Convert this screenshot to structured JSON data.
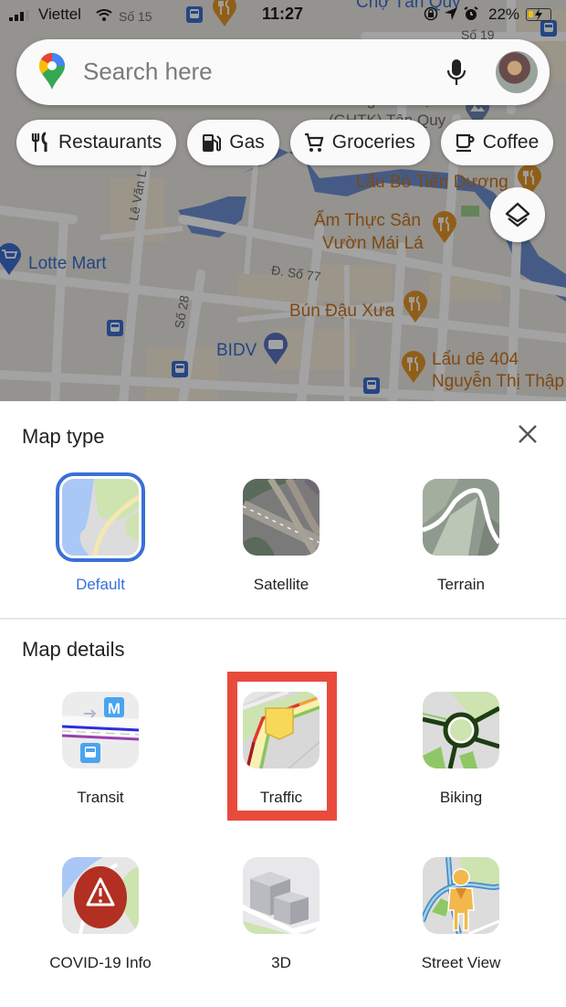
{
  "status_bar": {
    "carrier": "Viettel",
    "time": "11:27",
    "battery_percent": "22%",
    "icons": [
      "signal-icon",
      "wifi-icon",
      "orientation-lock-icon",
      "location-arrow-icon",
      "alarm-icon",
      "battery-charging-icon"
    ]
  },
  "search": {
    "placeholder": "Search here",
    "icons": [
      "google-maps-logo",
      "microphone-icon",
      "avatar"
    ]
  },
  "chips": [
    {
      "label": "Restaurants",
      "icon": "fork-knife-icon"
    },
    {
      "label": "Gas",
      "icon": "gas-pump-icon"
    },
    {
      "label": "Groceries",
      "icon": "cart-icon"
    },
    {
      "label": "Coffee",
      "icon": "coffee-cup-icon"
    }
  ],
  "map": {
    "labels": {
      "lau_bo": "Lẩu Bò Tiến Dương",
      "am_thuc_1": "Ẩm Thực Sân",
      "am_thuc_2": "Vườn Mái Lá",
      "lotte": "Lotte Mart",
      "street_77": "Đ. Số 77",
      "bun_dau": "Bún Đậu Xưa",
      "bidv": "BIDV",
      "lau_de_1": "Lẩu dê 404",
      "lau_de_2": "Nguyễn Thị Thập",
      "le_van": "Lê Văn L",
      "so_28": "Số 28",
      "so_19": "Số 19",
      "so_15": "Số 15",
      "cho": "Chợ Tân Quy",
      "giao_hang_1": "Giao Hàng Tiết Kiệm",
      "giao_hang_2": "(GHTK) Tân Quy"
    },
    "layers_button_icon": "layers-icon"
  },
  "sheet": {
    "map_type_title": "Map type",
    "map_details_title": "Map details",
    "close_icon": "close-icon",
    "map_types": [
      {
        "label": "Default",
        "selected": true
      },
      {
        "label": "Satellite",
        "selected": false
      },
      {
        "label": "Terrain",
        "selected": false
      }
    ],
    "map_details": [
      {
        "label": "Transit"
      },
      {
        "label": "Traffic",
        "highlighted": true
      },
      {
        "label": "Biking"
      },
      {
        "label": "COVID-19 Info"
      },
      {
        "label": "3D"
      },
      {
        "label": "Street View"
      }
    ]
  },
  "colors": {
    "accent_blue": "#3a6fd8",
    "highlight_red": "#e84b3c",
    "food_label": "#c5721c"
  }
}
